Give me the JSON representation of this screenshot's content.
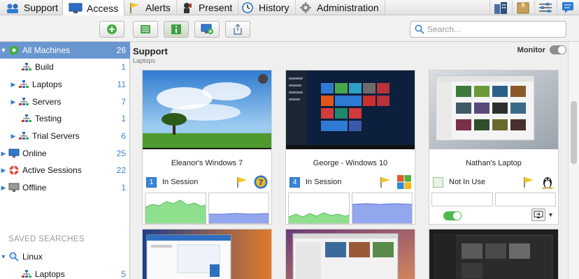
{
  "nav": {
    "tabs": [
      "Support",
      "Access",
      "Alerts",
      "Present",
      "History",
      "Administration"
    ],
    "active": "Access"
  },
  "search": {
    "placeholder": "Search..."
  },
  "sidebar": {
    "items": [
      {
        "label": "All Machines",
        "count": "26"
      },
      {
        "label": "Build",
        "count": "1"
      },
      {
        "label": "Laptops",
        "count": "11"
      },
      {
        "label": "Servers",
        "count": "7"
      },
      {
        "label": "Testing",
        "count": "1"
      },
      {
        "label": "Trial Servers",
        "count": "6"
      },
      {
        "label": "Online",
        "count": "25"
      },
      {
        "label": "Active Sessions",
        "count": "22"
      },
      {
        "label": "Offline",
        "count": "1"
      }
    ],
    "saved_header": "SAVED SEARCHES",
    "saved": [
      {
        "label": "Linux",
        "count": ""
      },
      {
        "label": "Laptops",
        "count": "5"
      }
    ]
  },
  "main": {
    "title": "Support",
    "subtitle": "Laptops",
    "monitor_label": "Monitor"
  },
  "cards": [
    {
      "name": "Eleanor's Windows 7",
      "num": "1",
      "status": "In Session",
      "os": "windows7-icon"
    },
    {
      "name": "George - Windows 10",
      "num": "4",
      "status": "In Session",
      "os": "windows10-icon"
    },
    {
      "name": "Nathan's Laptop",
      "num": "",
      "status": "Not In Use",
      "os": "linux-icon"
    }
  ],
  "colors": {
    "selection": "#6a96cf",
    "accent": "#3a85d5",
    "cpu_graph": "#8ee08e",
    "mem_graph": "#93a7ee",
    "toggle_on": "#4fb84f"
  }
}
